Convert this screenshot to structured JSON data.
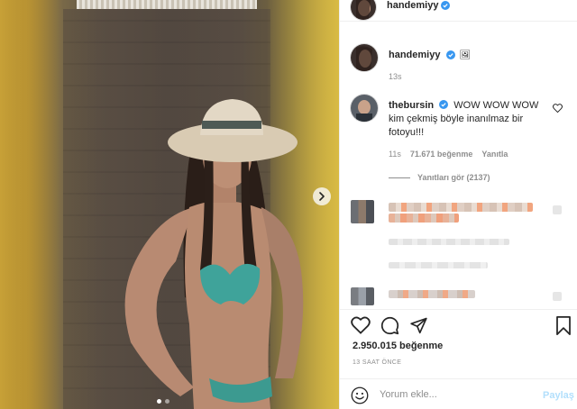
{
  "post": {
    "author": "handemiyy",
    "verified": true
  },
  "caption": {
    "author": "handemiyy",
    "emoji": "🖼",
    "time": "13s"
  },
  "comment": {
    "author": "thebursin",
    "text": "WOW WOW WOW kim çekmiş böyle inanılmaz bir fotoyu!!!",
    "time": "11s",
    "likes": "71.671 beğenme",
    "reply_label": "Yanıtla",
    "view_replies": "Yanıtları gör (2137)"
  },
  "likes_count": "2.950.015 beğenme",
  "posted_ago": "13 SAAT ÖNCE",
  "add_comment": {
    "placeholder": "Yorum ekle...",
    "post_label": "Paylaş"
  },
  "photo": {
    "carousel_dots": 2,
    "active_dot": 0
  },
  "colors": {
    "verified": "#3897f0",
    "post_button_disabled": "#b2dffc",
    "secondary_text": "#8e8e8e"
  },
  "icons": [
    "verified-icon",
    "heart-icon",
    "comment-icon",
    "share-icon",
    "bookmark-icon",
    "emoji-icon",
    "next-arrow-icon"
  ]
}
